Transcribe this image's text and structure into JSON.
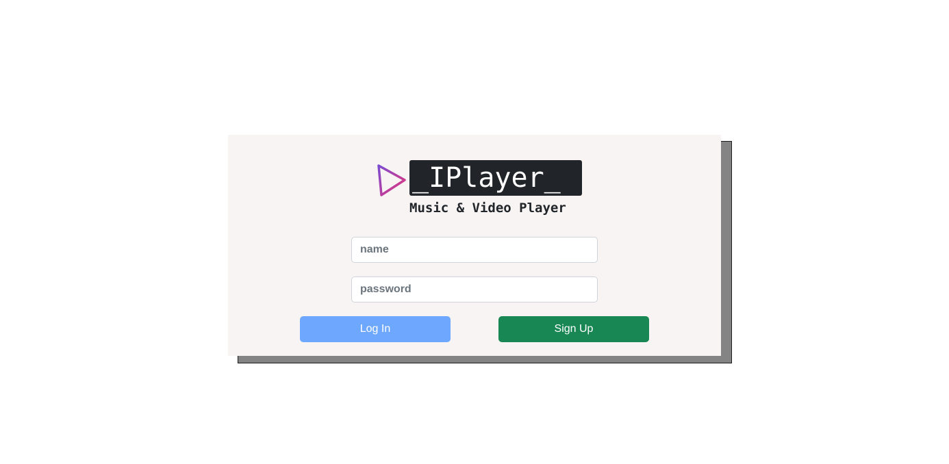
{
  "brand": {
    "title": "_IPlayer_",
    "subtitle": "Music & Video Player",
    "logo_icon": "play-triangle-icon"
  },
  "form": {
    "name_placeholder": "name",
    "name_value": "",
    "password_placeholder": "password",
    "password_value": ""
  },
  "actions": {
    "login_label": "Log In",
    "signup_label": "Sign Up"
  },
  "colors": {
    "login_button": "#6ea8fe",
    "signup_button": "#198754",
    "title_background": "#212529",
    "card_background": "#f7f4f3",
    "logo_gradient_start": "#8a3ffc",
    "logo_gradient_end": "#e83e8c"
  }
}
